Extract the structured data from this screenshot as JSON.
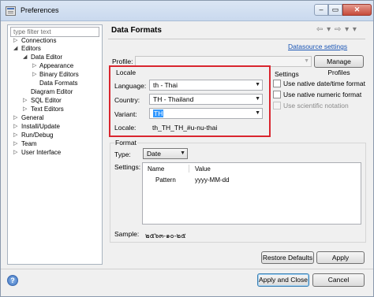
{
  "window": {
    "title": "Preferences",
    "min_glyph": "‒",
    "max_glyph": "▭",
    "close_glyph": "✕"
  },
  "filter": {
    "placeholder": "type filter text"
  },
  "tree": [
    {
      "label": "Connections",
      "expander": "▷"
    },
    {
      "label": "Editors",
      "expander": "◢"
    },
    {
      "label": "Data Editor",
      "expander": "◢"
    },
    {
      "label": "Appearance",
      "expander": "▷"
    },
    {
      "label": "Binary Editors",
      "expander": "▷"
    },
    {
      "label": "Data Formats",
      "expander": ""
    },
    {
      "label": "Diagram Editor",
      "expander": ""
    },
    {
      "label": "SQL Editor",
      "expander": "▷"
    },
    {
      "label": "Text Editors",
      "expander": "▷"
    },
    {
      "label": "General",
      "expander": "▷"
    },
    {
      "label": "Install/Update",
      "expander": "▷"
    },
    {
      "label": "Run/Debug",
      "expander": "▷"
    },
    {
      "label": "Team",
      "expander": "▷"
    },
    {
      "label": "User Interface",
      "expander": "▷"
    }
  ],
  "page": {
    "title": "Data Formats",
    "nav_glyphs": "⇦ ▾ ⇨ ▾ ▾",
    "datasource_link": "Datasource settings",
    "profile_label": "Profile:",
    "profile_value": "",
    "manage_profiles_label": "Manage Profiles"
  },
  "locale": {
    "group_title": "Locale",
    "language_label": "Language:",
    "language_value": "th - Thai",
    "country_label": "Country:",
    "country_value": "TH - Thailand",
    "variant_label": "Variant:",
    "variant_value": "TH",
    "locale_label": "Locale:",
    "locale_value": "th_TH_TH_#u-nu-thai"
  },
  "settings": {
    "group_title": "Settings",
    "checkboxes": [
      {
        "label": "Use native date/time format",
        "checked": false,
        "enabled": true
      },
      {
        "label": "Use native numeric format",
        "checked": false,
        "enabled": true
      },
      {
        "label": "Use scientific notation",
        "checked": false,
        "enabled": false
      }
    ]
  },
  "format": {
    "group_title": "Format",
    "type_label": "Type:",
    "type_value": "Date",
    "settings_label": "Settings:",
    "columns": [
      "Name",
      "Value"
    ],
    "rows": [
      {
        "name": "Pattern",
        "value": "yyyy-MM-dd"
      }
    ],
    "sample_label": "Sample:",
    "sample_value": "๒๕๖๓-๑๐-๒๕"
  },
  "buttons": {
    "dropdown_glyph": "▼",
    "restore_defaults": "Restore Defaults",
    "apply": "Apply",
    "apply_and_close": "Apply and Close",
    "cancel": "Cancel",
    "help_glyph": "?"
  }
}
